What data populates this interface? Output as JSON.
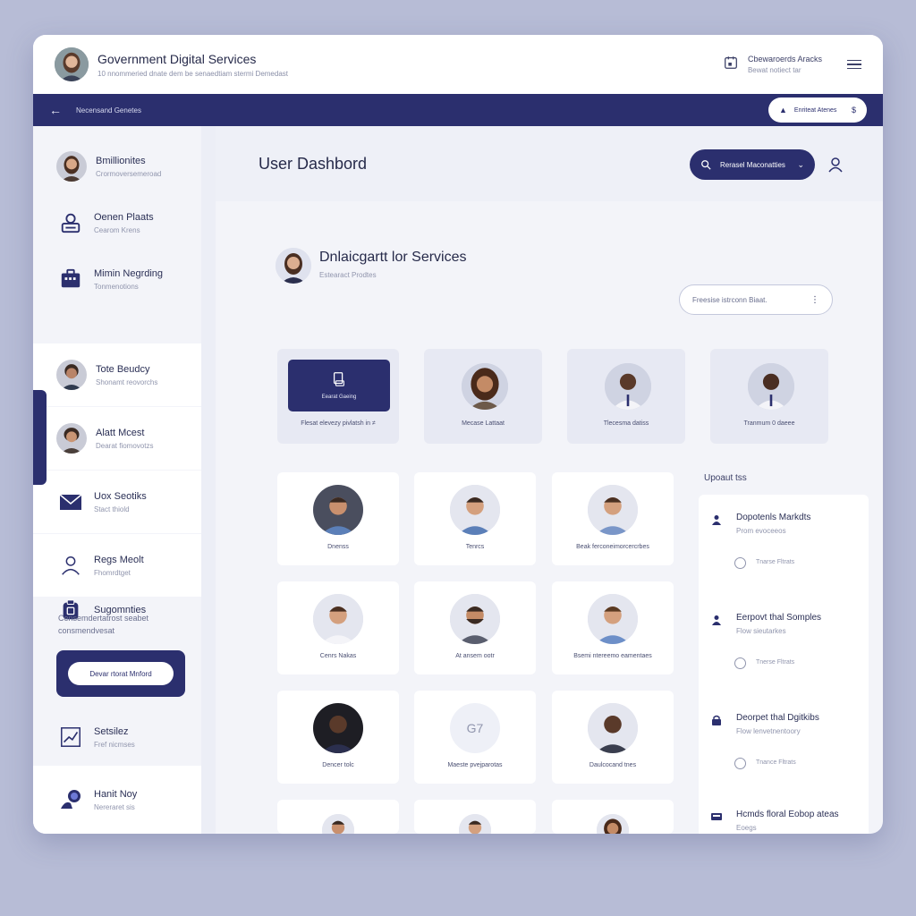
{
  "header": {
    "title": "Government Digital Services",
    "subtitle": "10 nnommeried dnate dem be senaedtiam stermi Demedast",
    "meta_line1": "Cbewaroerds Aracks",
    "meta_line2": "Bewat notiect tar"
  },
  "nav": {
    "breadcrumb": "Necensand Genetes",
    "pill_label": "Enriteat Atenes",
    "pill_end": "$"
  },
  "sidebar": {
    "items": [
      {
        "title": "Bmillionites",
        "sub": "Crormoversemeroad"
      },
      {
        "title": "Oenen Plaats",
        "sub": "Cearom Krens"
      },
      {
        "title": "Mimin Negrding",
        "sub": "Tonmenotions"
      },
      {
        "title": "Tote Beudcy",
        "sub": "Shonamt reovorchs"
      },
      {
        "title": "Alatt Mcest",
        "sub": "Dearat fiomovotzs"
      },
      {
        "title": "Uox Seotiks",
        "sub": "Stact thiold"
      },
      {
        "title": "Regs Meolt",
        "sub": "Fhomrdtget"
      },
      {
        "title": "Sugomnties",
        "sub": ""
      },
      {
        "title": "Setsilez",
        "sub": "Fref nicmses"
      },
      {
        "title": "Hanit Noy",
        "sub": "Nereraret sis"
      }
    ],
    "description": "Censemdertatrost seabet consmendvesat",
    "cta_label": "Devar rtorat Mnford"
  },
  "main": {
    "page_title": "User Dashbord",
    "search_label": "Rerasel Maconatties",
    "section_title": "Dnlaicgartt lor Services",
    "section_sub": "Estearact Prodtes",
    "filter_placeholder": "Freesise istrconn Biaat.",
    "filter_dots": "⋮",
    "service_button": "Eearat Gaeing",
    "top_cards": [
      {
        "label": "Flesat elevezy pivlatsh in ≠"
      },
      {
        "label": "Mecase Lattaat"
      },
      {
        "label": "Tlecesma datiss"
      },
      {
        "label": "Tranmum 0 daeee"
      }
    ],
    "people": [
      {
        "label": "Dnenss"
      },
      {
        "label": "Tenrcs"
      },
      {
        "label": "Beak ferconeimorcercrbes"
      },
      {
        "label": "Cenrs Nakas"
      },
      {
        "label": "At ansem ootr"
      },
      {
        "label": "Bsemi ntereemo eamentaes"
      },
      {
        "label": "Dencer tolc"
      },
      {
        "label": "Maeste pvejparotas"
      },
      {
        "label": "Daulcocand tnes"
      },
      {
        "label": ""
      },
      {
        "label": ""
      },
      {
        "label": ""
      }
    ],
    "initials_card": "G7"
  },
  "updates": {
    "heading": "Upoaut tss",
    "items": [
      {
        "title": "Dopotenls Markdts",
        "sub": "Prom evoceeos",
        "radio_label": "Tnarse Fltrats"
      },
      {
        "title": "Eerpovt thal Somples",
        "sub": "Flow sieutarkes",
        "radio_label": "Tnerse Fltrats"
      },
      {
        "title": "Deorpet thal Dgitkibs",
        "sub": "Flow lenvetnentoory",
        "radio_label": "Tnance Fltrats"
      },
      {
        "title": "Hcmds floral Eobop ateas",
        "sub": "Eoegs",
        "radio_label": ""
      }
    ]
  },
  "colors": {
    "brand_navy": "#2b2f6e",
    "page_bg": "#b7bcd6",
    "surface": "#f3f4f9"
  }
}
